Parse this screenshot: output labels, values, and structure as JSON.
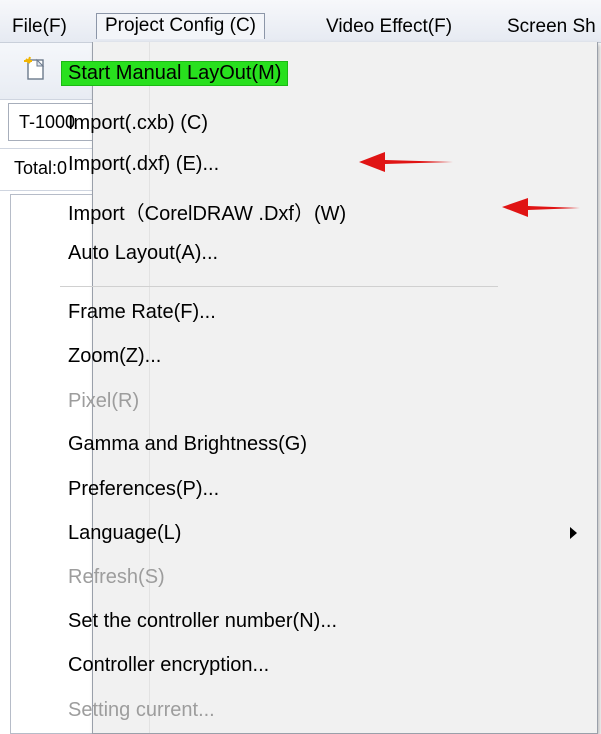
{
  "menubar": {
    "items": [
      "File(F)",
      "Project Config (C)",
      "Video Effect(F)",
      "Screen Sh"
    ]
  },
  "left": {
    "field_value": "T-1000",
    "total_label": "Total:0"
  },
  "dropdown": {
    "items": [
      "Start Manual LayOut(M)",
      "Import(.cxb) (C)",
      "Import(.dxf) (E)...",
      "Import（CorelDRAW .Dxf）(W)",
      "Auto Layout(A)...",
      "Frame Rate(F)...",
      "Zoom(Z)...",
      "Pixel(R)",
      "Gamma and Brightness(G)",
      "Preferences(P)...",
      "Language(L)",
      "Refresh(S)",
      "Set the controller number(N)...",
      "Controller encryption...",
      "Setting current..."
    ],
    "disabled_items": [
      "Pixel(R)",
      "Refresh(S)",
      "Setting current..."
    ],
    "highlight_color": "#28e01e",
    "annotation_arrow_color": "#e01414"
  }
}
